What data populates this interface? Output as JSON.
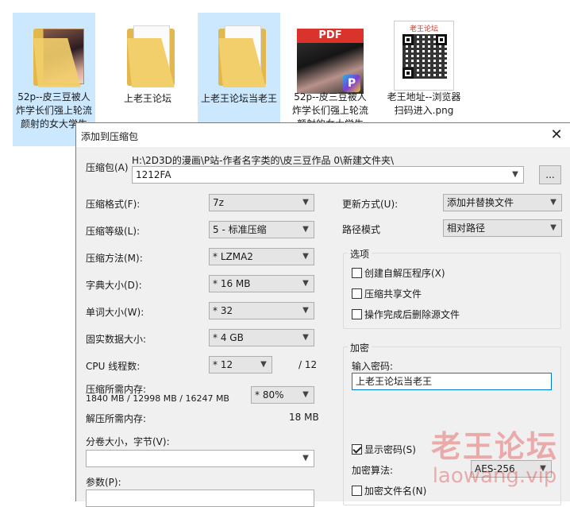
{
  "files": [
    {
      "name": "52p--皮三豆被人炸学长们强上轮流颜射的女大学生",
      "type": "image-folder",
      "selected": true
    },
    {
      "name": "上老王论坛",
      "type": "folder",
      "selected": false
    },
    {
      "name": "上老王论坛当老王",
      "type": "folder",
      "selected": true
    },
    {
      "name": "52p--皮三豆被人炸学长们强上轮流颜射的女大学生",
      "type": "pdf",
      "selected": false,
      "badge": "PDF",
      "app_badge": "P"
    },
    {
      "name": "老王地址--浏览器扫码进入.png",
      "type": "png",
      "selected": false,
      "qr_title": "老王论坛"
    }
  ],
  "dialog": {
    "title": "添加到压缩包",
    "close_glyph": "✕",
    "archive_label": "压缩包(A)",
    "archive_path": "H:\\2D3D的漫画\\P站-作者名字类的\\皮三豆作品 0\\新建文件夹\\",
    "archive_name": "1212FA",
    "browse_label": "...",
    "format_label": "压缩格式(F):",
    "format_value": "7z",
    "level_label": "压缩等级(L):",
    "level_value": "5 - 标准压缩",
    "method_label": "压缩方法(M):",
    "method_value": "* LZMA2",
    "dict_label": "字典大小(D):",
    "dict_value": "* 16 MB",
    "word_label": "单词大小(W):",
    "word_value": "* 32",
    "solid_label": "固实数据大小:",
    "solid_value": "* 4 GB",
    "cpu_label": "CPU 线程数:",
    "cpu_value": "* 12",
    "cpu_total": "/ 12",
    "mem_label": "压缩所需内存:",
    "mem_info": "1840 MB / 12998 MB / 16247 MB",
    "mem_value": "* 80%",
    "decomp_label": "解压所需内存:",
    "decomp_value": "18 MB",
    "split_label": "分卷大小，字节(V):",
    "split_value": "",
    "params_label": "参数(P):",
    "params_value": "",
    "update_label": "更新方式(U):",
    "update_value": "添加并替换文件",
    "pathmode_label": "路径模式",
    "pathmode_value": "相对路径",
    "options_title": "选项",
    "opt_sfx": "创建自解压程序(X)",
    "opt_shared": "压缩共享文件",
    "opt_delete": "操作完成后删除源文件",
    "encrypt_title": "加密",
    "password_label": "输入密码:",
    "password_value": "上老王论坛当老王",
    "show_password": "显示密码(S)",
    "enc_method_label": "加密算法:",
    "enc_method_value": "AES-256",
    "enc_names": "加密文件名(N)"
  },
  "watermark": {
    "cn": "老王论坛",
    "en": "laowang.vip"
  },
  "colors": {
    "selection": "#cce8ff",
    "dialog_bg": "#f0f0f0",
    "focus": "#0078d7",
    "pdf_red": "#d9332b"
  }
}
